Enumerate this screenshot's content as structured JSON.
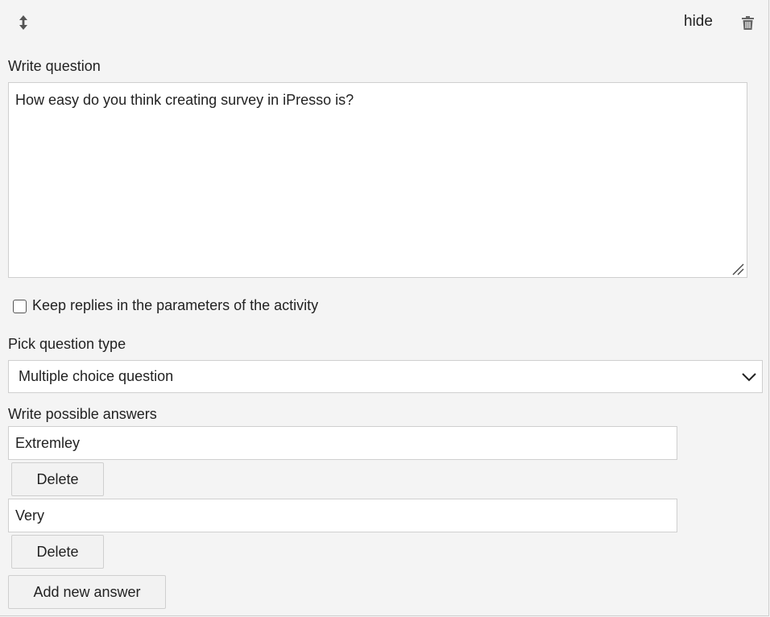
{
  "header": {
    "drag_icon": "updown-arrow-icon",
    "hide_label": "hide",
    "delete_icon": "trash-icon"
  },
  "question": {
    "label": "Write question",
    "value": "How easy do you think creating survey in iPresso is?"
  },
  "keep_replies": {
    "label": "Keep replies in the parameters of the activity",
    "checked": false
  },
  "question_type": {
    "label": "Pick question type",
    "selected": "Multiple choice question"
  },
  "answers": {
    "label": "Write possible answers",
    "items": [
      {
        "value": "Extremley",
        "delete_label": "Delete"
      },
      {
        "value": "Very",
        "delete_label": "Delete"
      }
    ],
    "add_label": "Add new answer"
  },
  "colors": {
    "background": "#f4f4f4",
    "input_background": "#ffffff",
    "border": "#cfcfcf",
    "text": "#222222"
  }
}
